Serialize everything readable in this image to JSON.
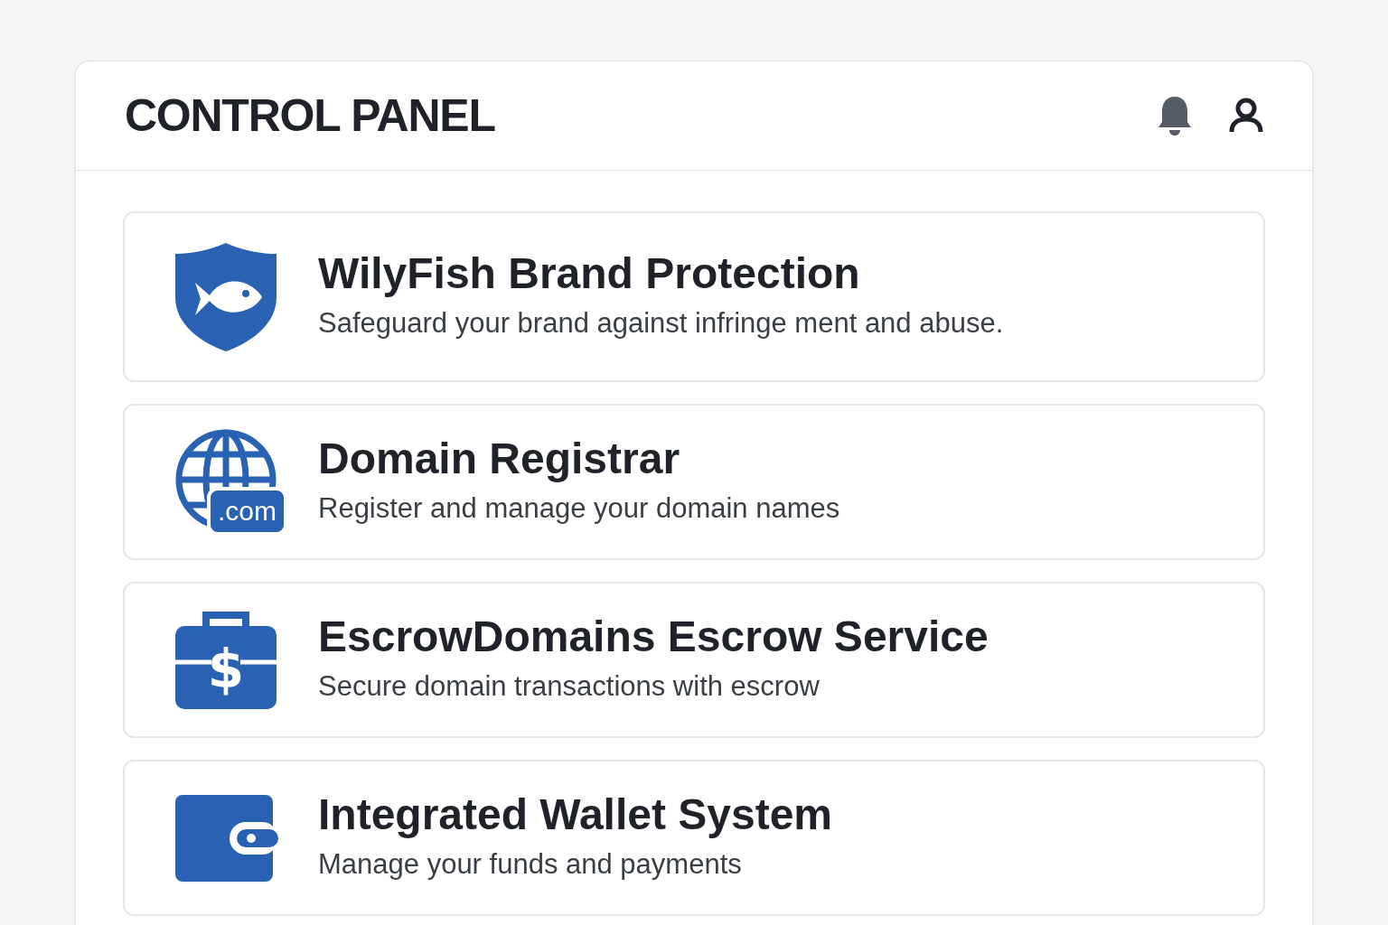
{
  "header": {
    "title": "CONTROL PANEL"
  },
  "services": [
    {
      "kind": "shield",
      "title": "WilyFish Brand Protection",
      "description": "Safeguard your brand against infringe ment and abuse."
    },
    {
      "kind": "globe",
      "title": "Domain Registrar",
      "description": "Register and manage your domain names",
      "icon_label": ".com"
    },
    {
      "kind": "briefcase",
      "title": "EscrowDomains Escrow Service",
      "description": "Secure domain transactions with escrow",
      "icon_label": "$"
    },
    {
      "kind": "wallet",
      "title": "Integrated Wallet System",
      "description": "Manage your funds and payments"
    }
  ]
}
